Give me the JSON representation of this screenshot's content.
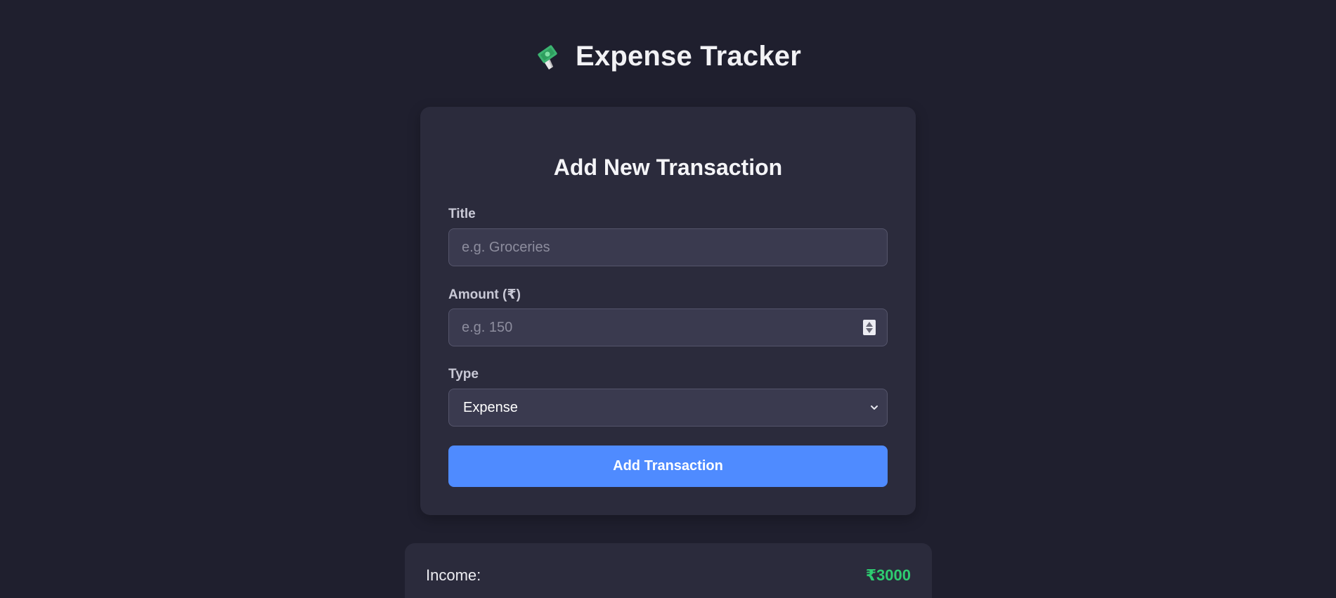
{
  "header": {
    "logo_icon": "money-with-wings-icon",
    "title": "Expense Tracker"
  },
  "form": {
    "heading": "Add New Transaction",
    "title_label": "Title",
    "title_placeholder": "e.g. Groceries",
    "title_value": "",
    "amount_label": "Amount (₹)",
    "amount_placeholder": "e.g. 150",
    "amount_value": "",
    "type_label": "Type",
    "type_selected": "Expense",
    "submit_label": "Add Transaction"
  },
  "summary": {
    "income_label": "Income:",
    "income_value": "₹3000"
  },
  "colors": {
    "background": "#1f1f2e",
    "card": "#2b2b3c",
    "accent": "#4f8bff",
    "income": "#2ecc71"
  }
}
